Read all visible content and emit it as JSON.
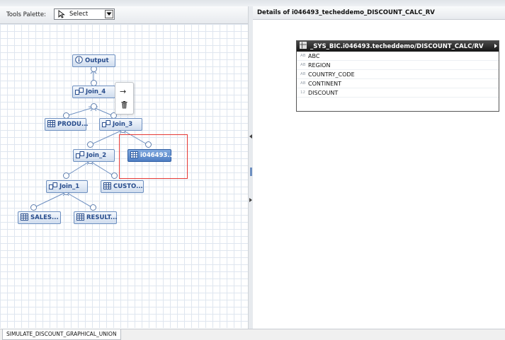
{
  "toolbar": {
    "palette_label": "Tools Palette:",
    "select_value": "Select"
  },
  "diagram": {
    "nodes": {
      "output": "Output",
      "join_4": "Join_4",
      "produ": "PRODU...",
      "join_3": "Join_3",
      "join_2": "Join_2",
      "i046493": "i046493...",
      "join_1": "Join_1",
      "custo": "CUSTO...",
      "sales": "SALES...",
      "result": "RESULT..."
    },
    "context_menu": {
      "move_glyph": "→"
    },
    "highlight_color": "#e53935"
  },
  "details": {
    "title": "Details of i046493_techeddemo_DISCOUNT_CALC_RV",
    "entity_name": "_SYS_BIC.i046493.techeddemo/DISCOUNT_CALC/RV",
    "columns": [
      {
        "type": "AB",
        "name": "ABC"
      },
      {
        "type": "AB",
        "name": "REGION"
      },
      {
        "type": "AB",
        "name": "COUNTRY_CODE"
      },
      {
        "type": "AB",
        "name": "CONTINENT"
      },
      {
        "type": "12",
        "name": "DISCOUNT"
      }
    ]
  },
  "status_bar": {
    "tab_label": "SIMULATE_DISCOUNT_GRAPHICAL_UNION"
  },
  "colors": {
    "node_text": "#274c8c",
    "node_border": "#6d8fc0",
    "selected_node": "#4f7fc4",
    "entity_header": "#151515"
  }
}
